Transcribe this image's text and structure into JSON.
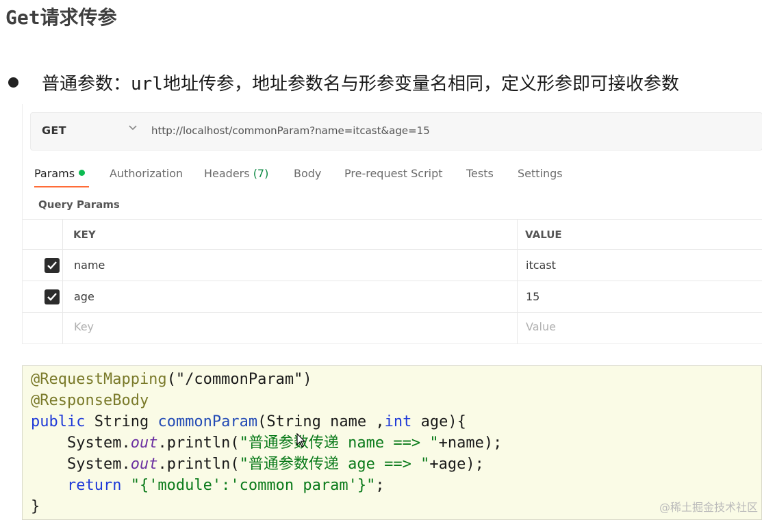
{
  "title": "Get请求传参",
  "bullet": "普通参数：url地址传参，地址参数名与形参变量名相同，定义形参即可接收参数",
  "request": {
    "method": "GET",
    "url": "http://localhost/commonParam?name=itcast&age=15",
    "tabs": [
      {
        "label": "Params",
        "indicator": "dot"
      },
      {
        "label": "Authorization"
      },
      {
        "label": "Headers",
        "count": "(7)"
      },
      {
        "label": "Body"
      },
      {
        "label": "Pre-request Script"
      },
      {
        "label": "Tests"
      },
      {
        "label": "Settings"
      }
    ],
    "section_label": "Query Params",
    "columns": {
      "key": "KEY",
      "value": "VALUE"
    },
    "rows": [
      {
        "checked": true,
        "key": "name",
        "value": "itcast"
      },
      {
        "checked": true,
        "key": "age",
        "value": "15"
      }
    ],
    "placeholder": {
      "key": "Key",
      "value": "Value"
    }
  },
  "code": {
    "l1_ann": "@RequestMapping",
    "l1_rest": "(\"/commonParam\")",
    "l2_ann": "@ResponseBody",
    "l3_kw1": "public",
    "l3_a": " String ",
    "l3_method": "commonParam",
    "l3_b": "(String name ,",
    "l3_kw2": "int",
    "l3_c": " age){",
    "l4_a": "    System.",
    "l4_out": "out",
    "l4_b": ".println(",
    "l4_str": "\"普通参数传递 name ==> \"",
    "l4_c": "+name);",
    "l5_a": "    System.",
    "l5_out": "out",
    "l5_b": ".println(",
    "l5_str": "\"普通参数传递 age ==> \"",
    "l5_c": "+age);",
    "l6_kw": "    return",
    "l6_str": " \"{'module':'common param'}\"",
    "l6_c": ";",
    "l7": "}"
  },
  "watermark": "@稀土掘金技术社区",
  "colors": {
    "accent": "#ff6c37",
    "dot": "#0cbb52",
    "count": "#0f8a45",
    "code_bg": "#fafbe6"
  }
}
